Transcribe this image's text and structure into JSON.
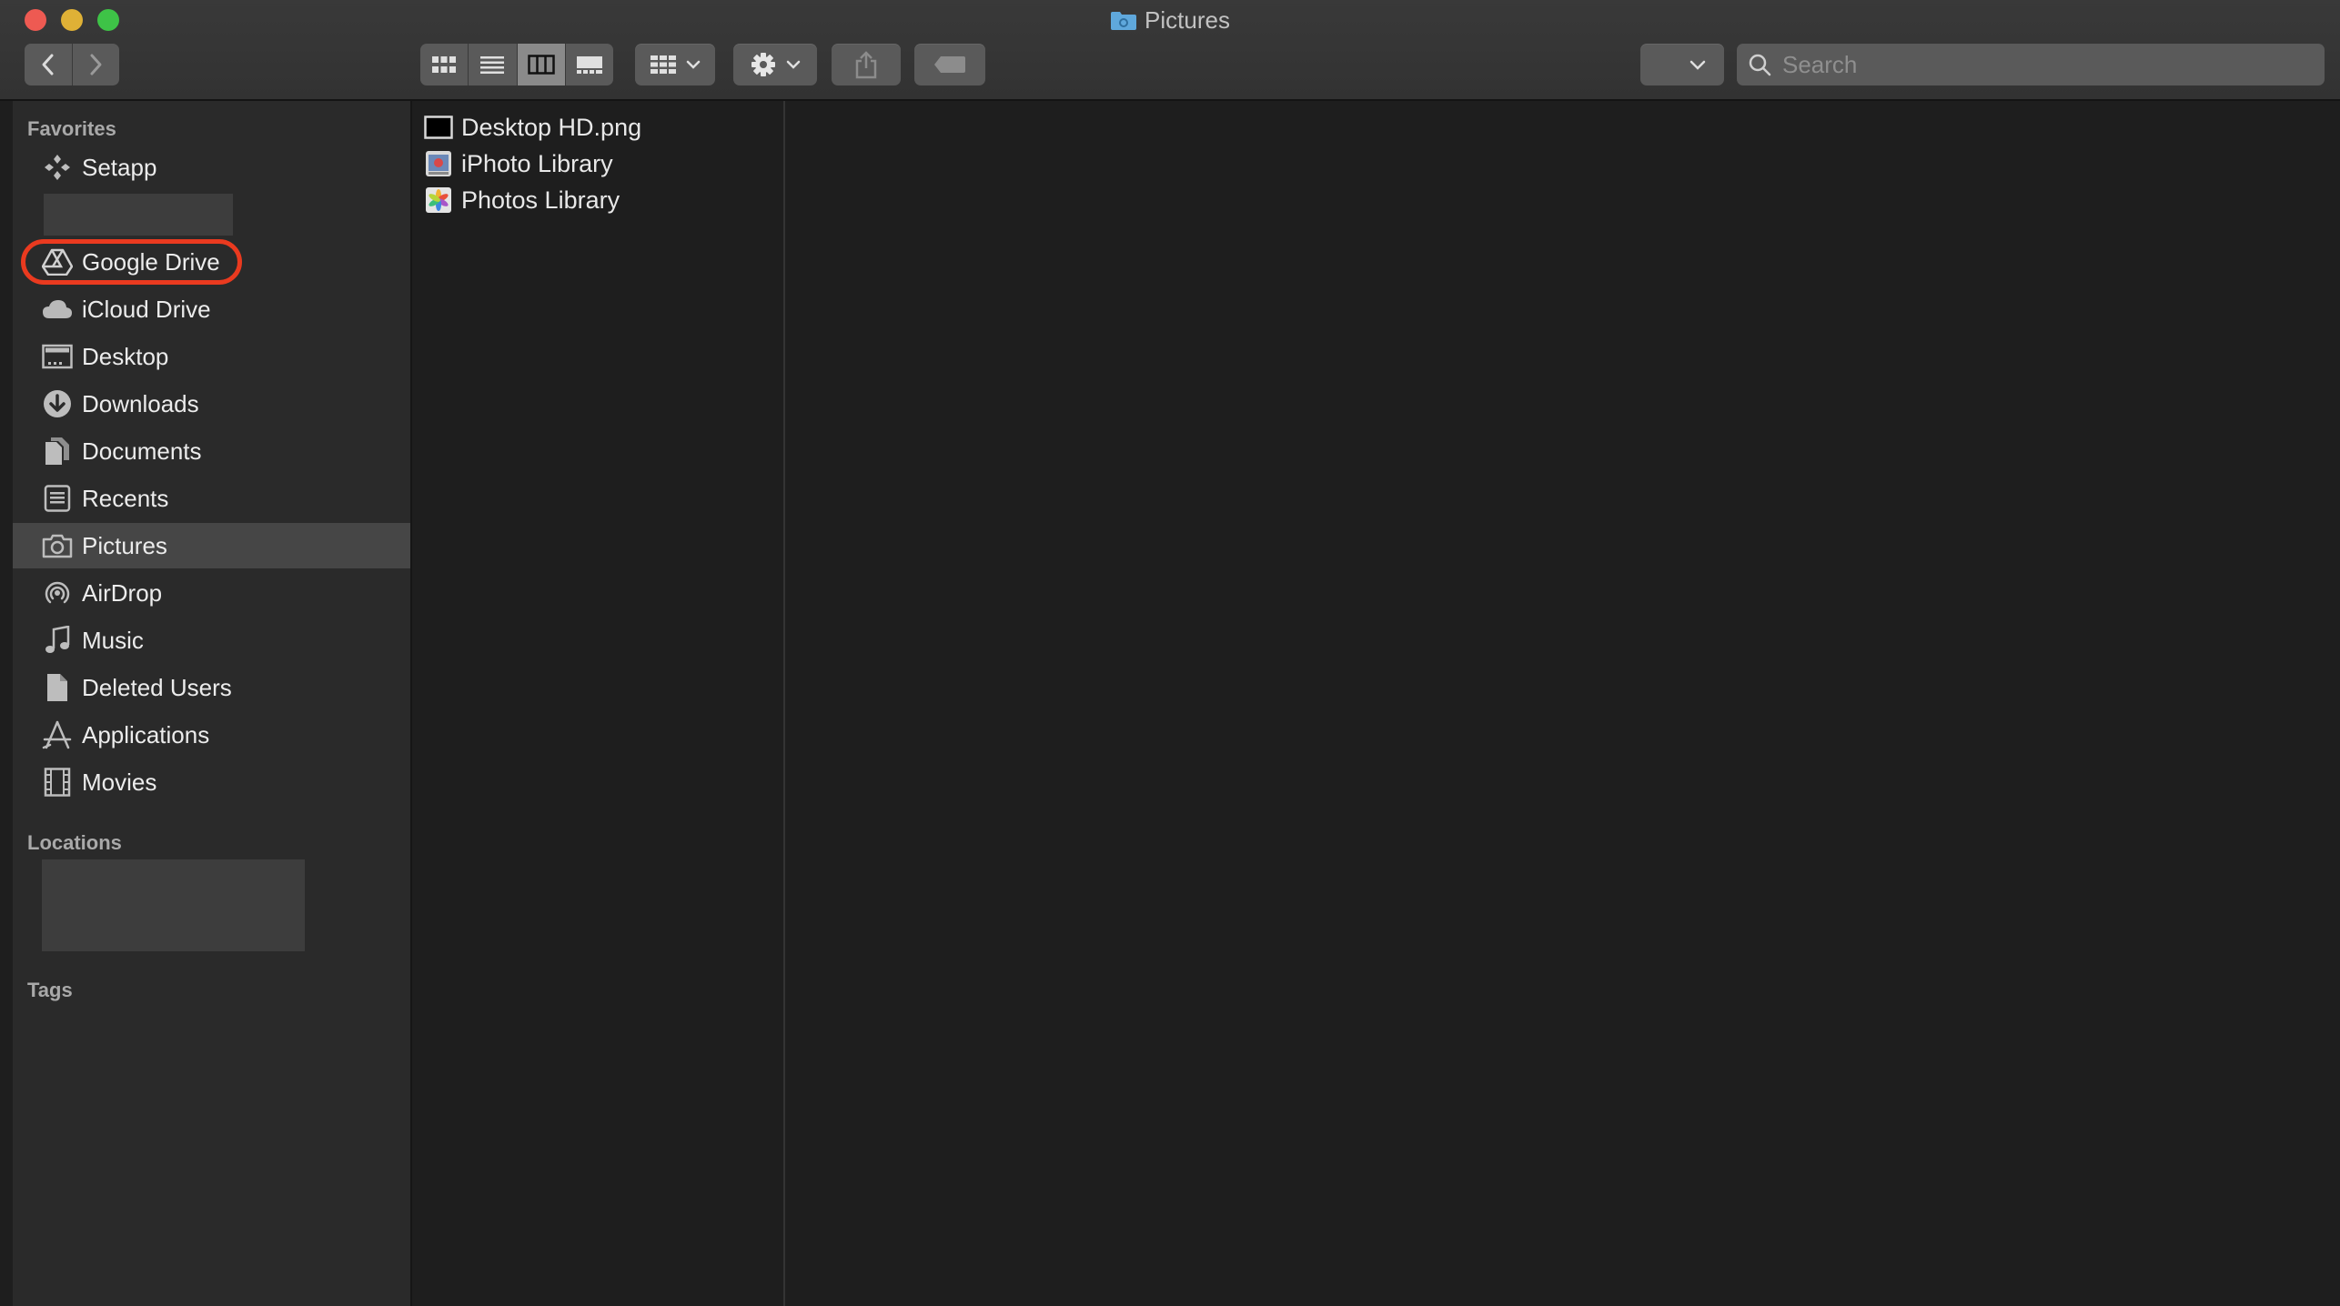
{
  "window": {
    "title": "Pictures",
    "title_icon": "folder-icon"
  },
  "toolbar": {
    "back_icon": "chevron-left-icon",
    "forward_icon": "chevron-right-icon",
    "view_modes": [
      "icon-view",
      "list-view",
      "column-view",
      "gallery-view"
    ],
    "active_view": "column-view",
    "group_icon": "grid-icon",
    "action_icon": "gear-icon",
    "share_icon": "share-icon",
    "tag_icon": "tag-icon",
    "search": {
      "placeholder": "Search",
      "value": ""
    }
  },
  "sidebar": {
    "favorites_header": "Favorites",
    "items": [
      {
        "label": "Setapp",
        "icon": "setapp-icon"
      },
      {
        "label": "Google Drive",
        "icon": "google-drive-icon",
        "highlighted": true
      },
      {
        "label": "iCloud Drive",
        "icon": "cloud-icon"
      },
      {
        "label": "Desktop",
        "icon": "desktop-icon"
      },
      {
        "label": "Downloads",
        "icon": "download-icon"
      },
      {
        "label": "Documents",
        "icon": "documents-icon"
      },
      {
        "label": "Recents",
        "icon": "recents-icon"
      },
      {
        "label": "Pictures",
        "icon": "camera-icon",
        "selected": true
      },
      {
        "label": "AirDrop",
        "icon": "airdrop-icon"
      },
      {
        "label": "Music",
        "icon": "music-note-icon"
      },
      {
        "label": "Deleted Users",
        "icon": "file-icon"
      },
      {
        "label": "Applications",
        "icon": "applications-icon"
      },
      {
        "label": "Movies",
        "icon": "film-icon"
      }
    ],
    "locations_header": "Locations",
    "tags_header": "Tags"
  },
  "column1": {
    "files": [
      {
        "name": "Desktop HD.png",
        "icon": "image-file-icon"
      },
      {
        "name": "iPhoto Library",
        "icon": "iphoto-icon"
      },
      {
        "name": "Photos Library",
        "icon": "photos-icon"
      }
    ]
  },
  "colors": {
    "titlebar": "#353535",
    "sidebar": "#2a2a2a",
    "content": "#1e1e1e",
    "selection": "#464646",
    "highlight_ring": "#ea3a1f"
  }
}
